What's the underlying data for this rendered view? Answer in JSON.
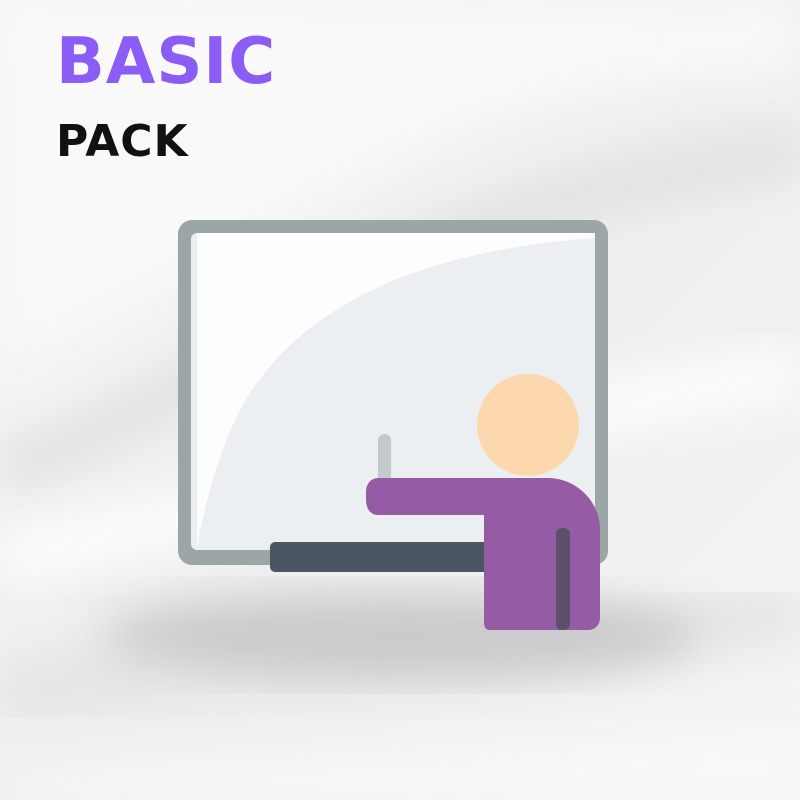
{
  "title": {
    "main": "BASIC",
    "sub": "PACK"
  },
  "colors": {
    "title_main": "#8b5cf6",
    "title_sub": "#111111",
    "background": "#f1f1f2",
    "board_frame": "#9ca6a6",
    "board_surface": "#eceff1",
    "board_highlight": "#ffffff",
    "board_tray": "#4b5563",
    "marker": "#c4c9ce",
    "head": "#fdd7ad",
    "body": "#955ba5",
    "arm_shadow": "#5c4f6b",
    "floor_shadow": "#c9c9cb"
  },
  "illustration": {
    "icon": "teacher-at-whiteboard-icon"
  }
}
